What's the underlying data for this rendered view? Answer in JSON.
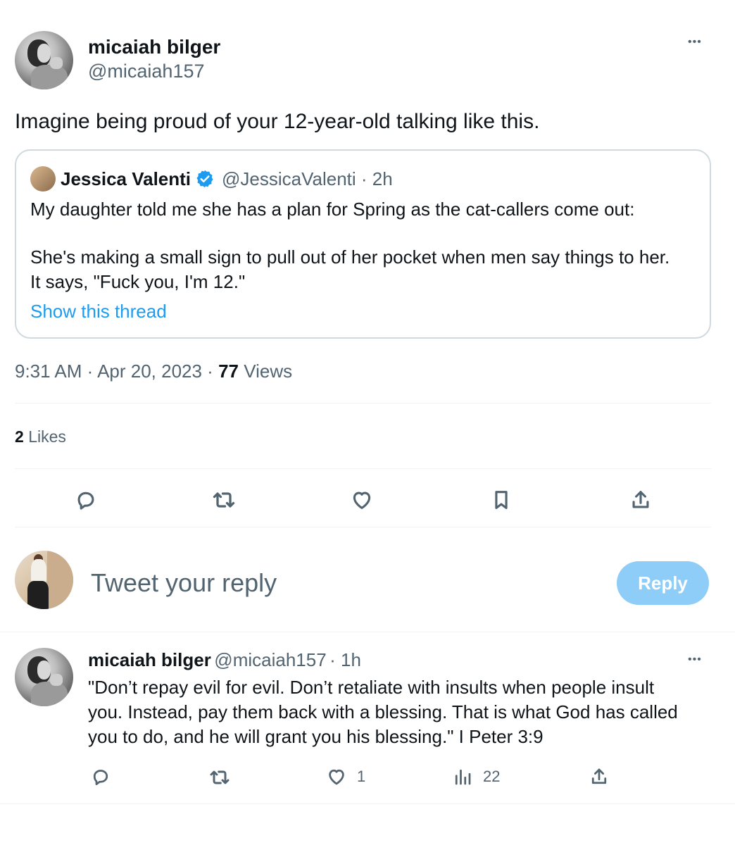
{
  "tweet": {
    "author_name": "micaiah bilger",
    "author_handle": "@micaiah157",
    "more": "•••",
    "text": "Imagine being proud of your 12-year-old talking like this.",
    "time": "9:31 AM · Apr 20, 2023 ·",
    "views_count": "77",
    "views_label": "Views",
    "likes_count": "2",
    "likes_label": "Likes"
  },
  "quoted": {
    "author_name": "Jessica Valenti",
    "author_handle": "@JessicaValenti",
    "age": "· 2h",
    "line1": "My daughter told me she has a plan for Spring as the cat-callers come out:",
    "line2": "She's making a small sign to pull out of her pocket when men say things to her.",
    "line3": "It says, \"Fuck you, I'm 12.\"",
    "thread_link": "Show this thread"
  },
  "actions": {
    "icons": [
      "reply-icon",
      "retweet-icon",
      "like-icon",
      "bookmark-icon",
      "share-icon"
    ]
  },
  "composer": {
    "placeholder": "Tweet your reply",
    "button_label": "Reply"
  },
  "reply": {
    "author_name": "micaiah bilger",
    "author_handle": "@micaiah157",
    "age": "· 1h",
    "more": "•••",
    "line1": "\"Don’t repay evil for evil. Don’t retaliate with insults when people insult",
    "line2": "you. Instead, pay them back with a blessing. That is what God has called",
    "line3": "you to do, and he will grant you his blessing.\" I Peter 3:9",
    "like_count": "1",
    "view_count": "22"
  },
  "colors": {
    "link": "#1d9bf0",
    "muted": "#536471",
    "reply_button": "#8ecdf8",
    "verified": "#1d9bf0"
  }
}
